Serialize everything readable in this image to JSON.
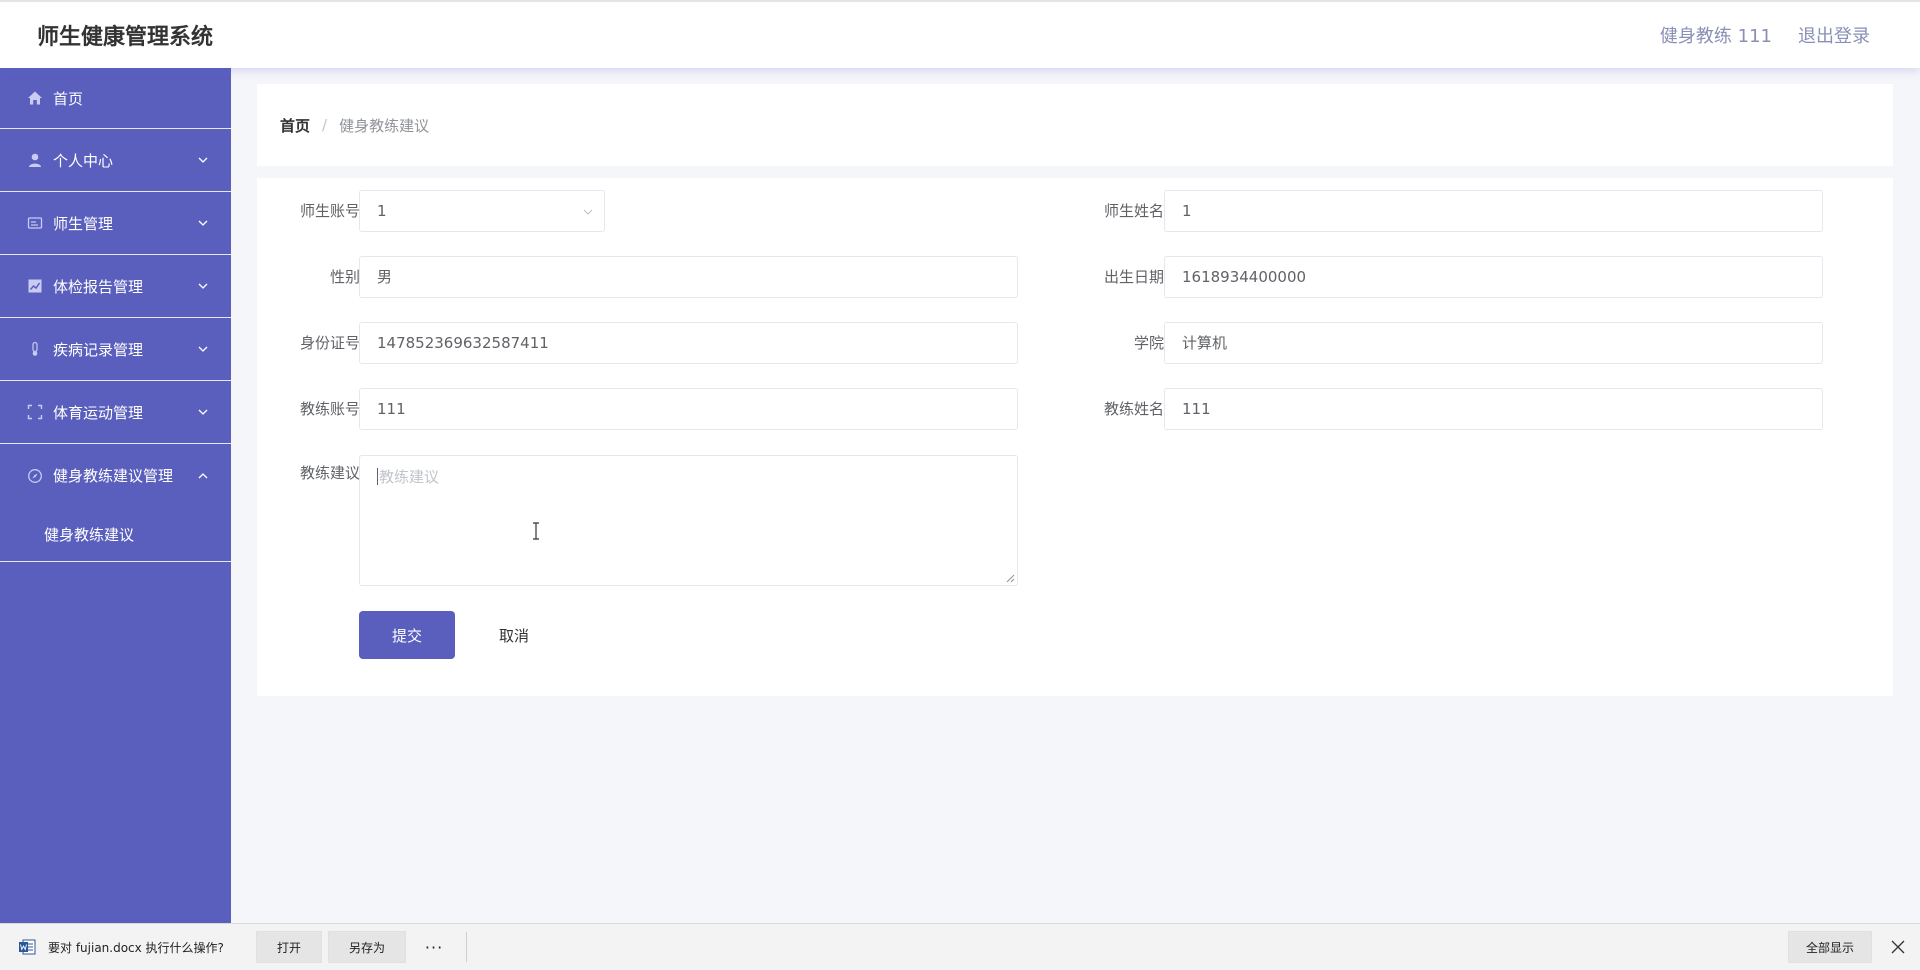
{
  "header": {
    "app_title": "师生健康管理系统",
    "user_label": "健身教练 111",
    "logout_label": "退出登录"
  },
  "sidebar": {
    "items": [
      {
        "label": "首页",
        "icon": "home-icon"
      },
      {
        "label": "个人中心",
        "icon": "user-icon"
      },
      {
        "label": "师生管理",
        "icon": "id-card-icon"
      },
      {
        "label": "体检报告管理",
        "icon": "chart-icon"
      },
      {
        "label": "疾病记录管理",
        "icon": "thermometer-icon"
      },
      {
        "label": "体育运动管理",
        "icon": "fullscreen-icon"
      },
      {
        "label": "健身教练建议管理",
        "icon": "compass-icon"
      }
    ],
    "submenu": {
      "label": "健身教练建议"
    }
  },
  "breadcrumb": {
    "home": "首页",
    "separator": "/",
    "current": "健身教练建议"
  },
  "form": {
    "account_label": "师生账号",
    "account_value": "1",
    "name_label": "师生姓名",
    "name_value": "1",
    "gender_label": "性别",
    "gender_value": "男",
    "birth_label": "出生日期",
    "birth_value": "1618934400000",
    "idcard_label": "身份证号",
    "idcard_value": "147852369632587411",
    "college_label": "学院",
    "college_value": "计算机",
    "coach_account_label": "教练账号",
    "coach_account_value": "111",
    "coach_name_label": "教练姓名",
    "coach_name_value": "111",
    "advice_label": "教练建议",
    "advice_placeholder": "教练建议",
    "submit_label": "提交",
    "cancel_label": "取消"
  },
  "download_bar": {
    "prompt": "要对 fujian.docx 执行什么操作?",
    "open_label": "打开",
    "save_as_label": "另存为",
    "more_label": "···",
    "show_all_label": "全部显示"
  },
  "colors": {
    "sidebar_bg": "#5a5fbe",
    "primary": "#5a5fbe",
    "page_bg": "#f5f6fa"
  }
}
